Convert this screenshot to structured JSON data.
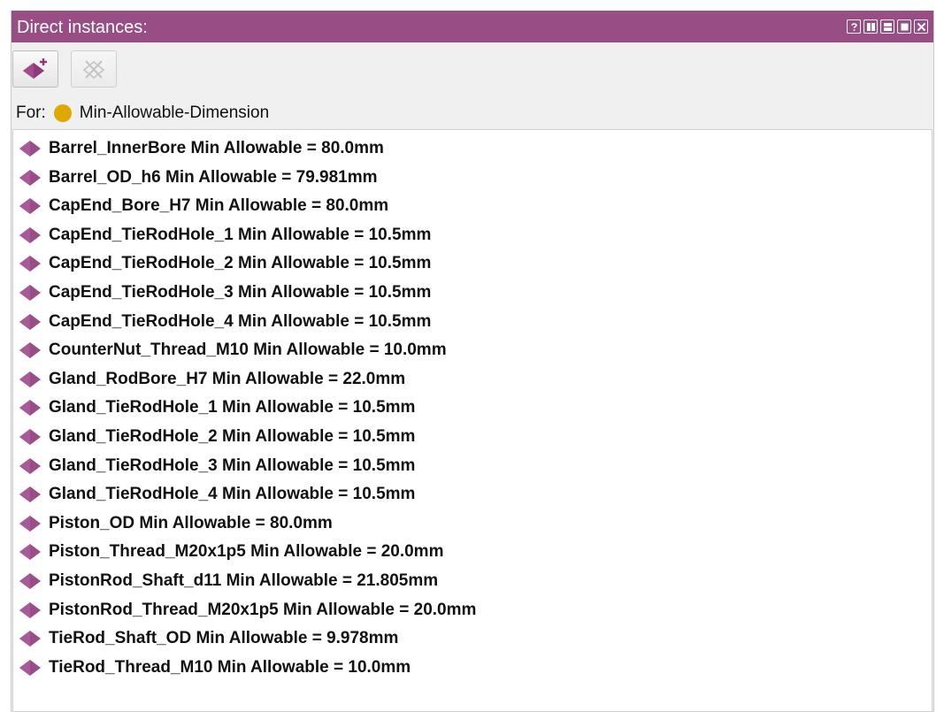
{
  "panel": {
    "title": "Direct instances:",
    "accent_color": "#994d85",
    "window_buttons": [
      "help-icon",
      "split-vertical-icon",
      "split-horizontal-icon",
      "maximize-icon",
      "close-icon"
    ]
  },
  "toolbar": {
    "add_instance_icon": "add-instance-icon",
    "delete_instance_icon": "delete-instance-icon"
  },
  "for_row": {
    "label": "For:",
    "class_name": "Min-Allowable-Dimension",
    "class_color": "#e0a800"
  },
  "instances": {
    "item_color": "#994d85",
    "items": [
      {
        "label": "Barrel_InnerBore Min Allowable = 80.0mm"
      },
      {
        "label": "Barrel_OD_h6 Min Allowable = 79.981mm"
      },
      {
        "label": "CapEnd_Bore_H7 Min Allowable = 80.0mm"
      },
      {
        "label": "CapEnd_TieRodHole_1 Min Allowable = 10.5mm"
      },
      {
        "label": "CapEnd_TieRodHole_2 Min Allowable = 10.5mm"
      },
      {
        "label": "CapEnd_TieRodHole_3 Min Allowable = 10.5mm"
      },
      {
        "label": "CapEnd_TieRodHole_4 Min Allowable = 10.5mm"
      },
      {
        "label": "CounterNut_Thread_M10 Min Allowable = 10.0mm"
      },
      {
        "label": "Gland_RodBore_H7 Min Allowable = 22.0mm"
      },
      {
        "label": "Gland_TieRodHole_1 Min Allowable = 10.5mm"
      },
      {
        "label": "Gland_TieRodHole_2 Min Allowable = 10.5mm"
      },
      {
        "label": "Gland_TieRodHole_3 Min Allowable = 10.5mm"
      },
      {
        "label": "Gland_TieRodHole_4 Min Allowable = 10.5mm"
      },
      {
        "label": "Piston_OD Min Allowable = 80.0mm"
      },
      {
        "label": "Piston_Thread_M20x1p5 Min Allowable = 20.0mm"
      },
      {
        "label": "PistonRod_Shaft_d11 Min Allowable = 21.805mm"
      },
      {
        "label": "PistonRod_Thread_M20x1p5 Min Allowable = 20.0mm"
      },
      {
        "label": "TieRod_Shaft_OD Min Allowable = 9.978mm"
      },
      {
        "label": "TieRod_Thread_M10 Min Allowable = 10.0mm"
      }
    ]
  }
}
